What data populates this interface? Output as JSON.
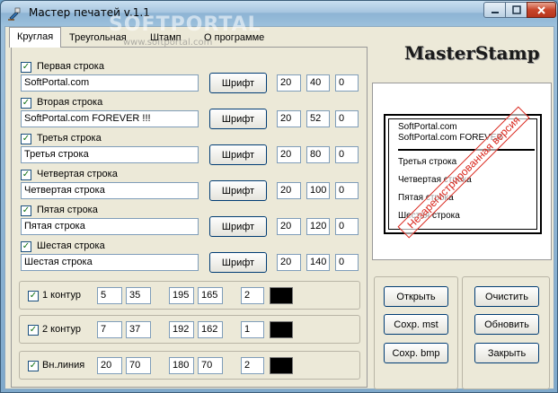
{
  "window": {
    "title": "Мастер печатей v.1.1"
  },
  "watermark": {
    "text": "SOFTPORTAL",
    "url": "www.softportal.com"
  },
  "tabs": [
    {
      "label": "Круглая",
      "active": true
    },
    {
      "label": "Треугольная",
      "active": false
    },
    {
      "label": "Штамп",
      "active": false
    },
    {
      "label": "О программе",
      "active": false
    }
  ],
  "lines": [
    {
      "label": "Первая строка",
      "checked": true,
      "text": "SoftPortal.com",
      "font_button": "Шрифт",
      "v1": "20",
      "v2": "40",
      "v3": "0"
    },
    {
      "label": "Вторая строка",
      "checked": true,
      "text": "SoftPortal.com FOREVER !!!",
      "font_button": "Шрифт",
      "v1": "20",
      "v2": "52",
      "v3": "0"
    },
    {
      "label": "Третья строка",
      "checked": true,
      "text": "Третья строка",
      "font_button": "Шрифт",
      "v1": "20",
      "v2": "80",
      "v3": "0"
    },
    {
      "label": "Четвертая строка",
      "checked": true,
      "text": "Четвертая строка",
      "font_button": "Шрифт",
      "v1": "20",
      "v2": "100",
      "v3": "0"
    },
    {
      "label": "Пятая строка",
      "checked": true,
      "text": "Пятая строка",
      "font_button": "Шрифт",
      "v1": "20",
      "v2": "120",
      "v3": "0"
    },
    {
      "label": "Шестая строка",
      "checked": true,
      "text": "Шестая строка",
      "font_button": "Шрифт",
      "v1": "20",
      "v2": "140",
      "v3": "0"
    }
  ],
  "contours": [
    {
      "label": "1 контур",
      "checked": true,
      "a": "5",
      "b": "35",
      "c": "195",
      "d": "165",
      "width": "2",
      "color": "#000000"
    },
    {
      "label": "2 контур",
      "checked": true,
      "a": "7",
      "b": "37",
      "c": "192",
      "d": "162",
      "width": "1",
      "color": "#000000"
    },
    {
      "label": "Вн.линия",
      "checked": true,
      "a": "20",
      "b": "70",
      "c": "180",
      "d": "70",
      "width": "2",
      "color": "#000000"
    }
  ],
  "brand": "MasterStamp",
  "preview": {
    "lines": [
      "SoftPortal.com",
      "SoftPortal.com FOREVER",
      "Третья строка",
      "Четвертая строка",
      "Пятая строка",
      "Шестая строка"
    ],
    "overlay": "Незарегистрированная версия"
  },
  "buttons": {
    "open": "Открыть",
    "save_mst": "Сохр. mst",
    "save_bmp": "Сохр. bmp",
    "clear": "Очистить",
    "refresh": "Обновить",
    "close": "Закрыть"
  },
  "colors": {
    "accent_red": "#d9261c",
    "face": "#ece9d8"
  }
}
